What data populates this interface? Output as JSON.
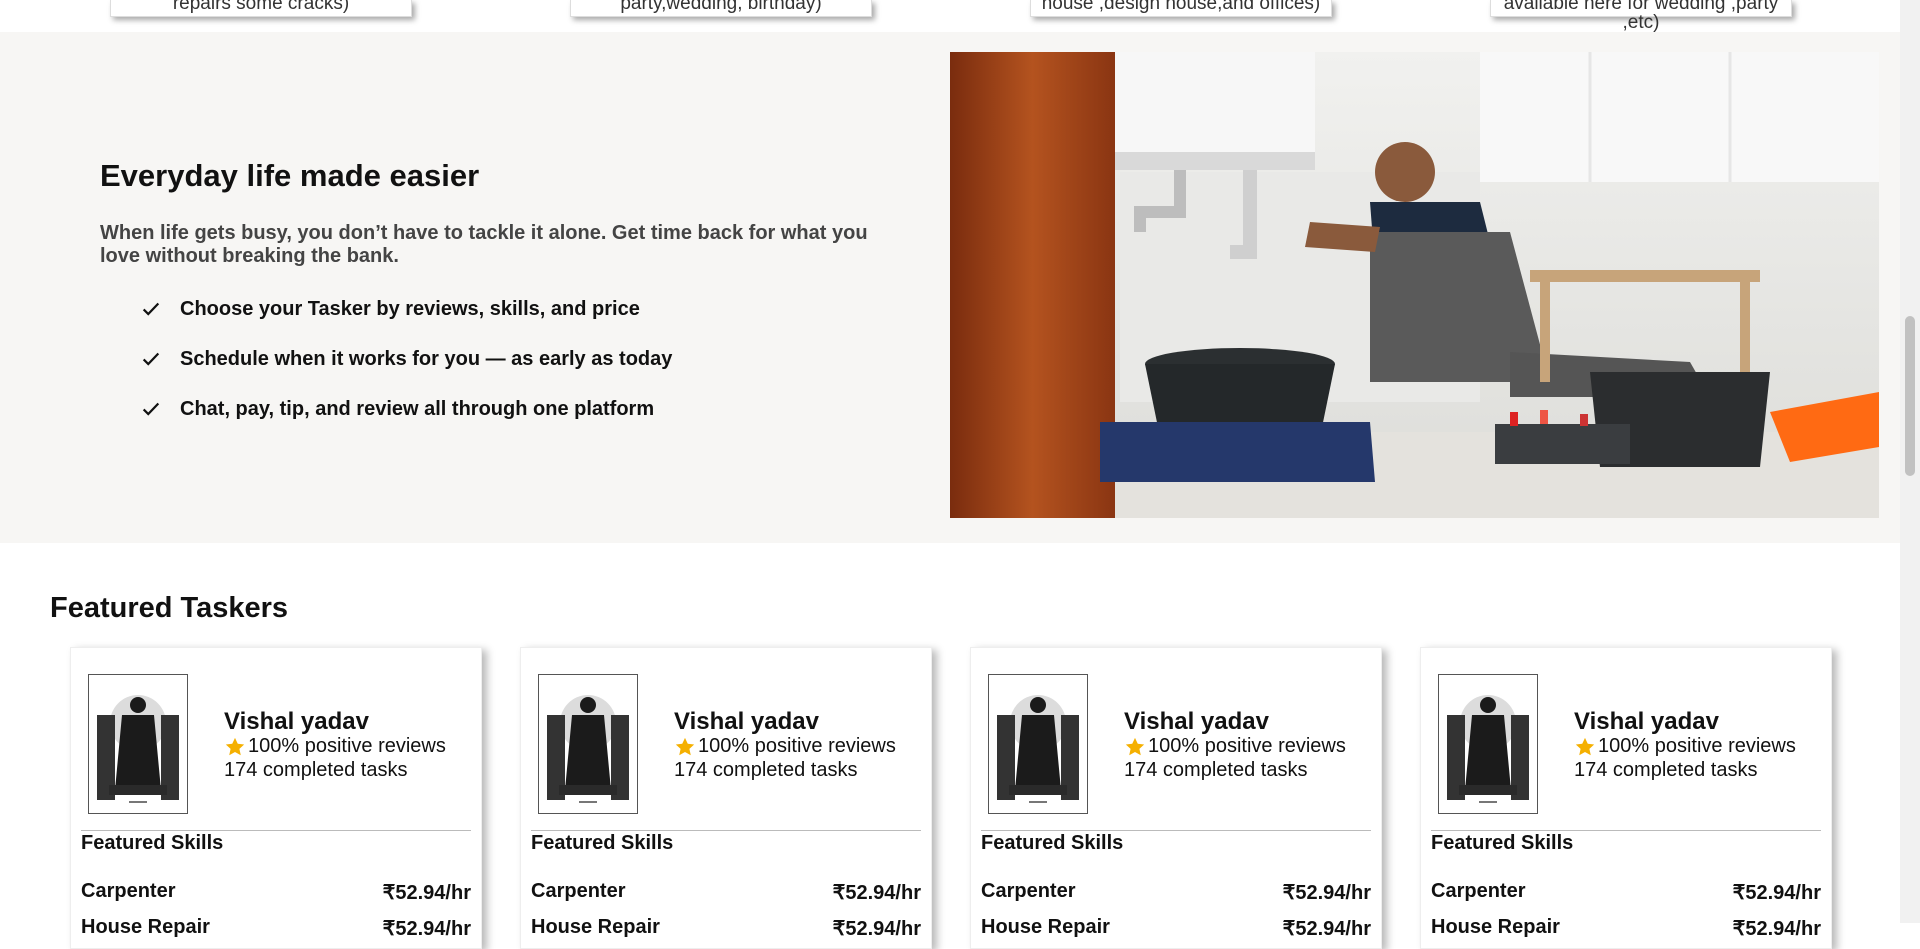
{
  "services": [
    {
      "text": "repairs some cracks)",
      "extra": ""
    },
    {
      "text": "party,wedding, birthday)",
      "extra": ""
    },
    {
      "text": "house ,design house,and offices)",
      "extra": ""
    },
    {
      "text": "available here for wedding ,party",
      "extra": ",etc)"
    }
  ],
  "hero": {
    "title": "Everyday life made easier",
    "description": "When life gets busy, you don’t have to tackle it alone. Get time back for what you love without breaking the bank.",
    "benefits": [
      "Choose your Tasker by reviews, skills, and price",
      "Schedule when it works for you — as early as today",
      "Chat, pay, tip, and review all through one platform"
    ],
    "image_icon": "plumber-photo"
  },
  "featured": {
    "title": "Featured Taskers",
    "taskers": [
      {
        "name": "Vishal yadav",
        "reviews": "100% positive reviews",
        "tasks": "174 completed tasks",
        "skills_head": "Featured Skills",
        "skills": [
          {
            "name": "Carpenter",
            "price": "₹52.94/hr"
          },
          {
            "name": "House Repair",
            "price": "₹52.94/hr"
          }
        ]
      },
      {
        "name": "Vishal yadav",
        "reviews": "100% positive reviews",
        "tasks": "174 completed tasks",
        "skills_head": "Featured Skills",
        "skills": [
          {
            "name": "Carpenter",
            "price": "₹52.94/hr"
          },
          {
            "name": "House Repair",
            "price": "₹52.94/hr"
          }
        ]
      },
      {
        "name": "Vishal yadav",
        "reviews": "100% positive reviews",
        "tasks": "174 completed tasks",
        "skills_head": "Featured Skills",
        "skills": [
          {
            "name": "Carpenter",
            "price": "₹52.94/hr"
          },
          {
            "name": "House Repair",
            "price": "₹52.94/hr"
          }
        ]
      },
      {
        "name": "Vishal yadav",
        "reviews": "100% positive reviews",
        "tasks": "174 completed tasks",
        "skills_head": "Featured Skills",
        "skills": [
          {
            "name": "Carpenter",
            "price": "₹52.94/hr"
          },
          {
            "name": "House Repair",
            "price": "₹52.94/hr"
          }
        ]
      }
    ]
  },
  "colors": {
    "hero_bg": "#f7f6f4",
    "star": "#f5b000",
    "text": "#111111"
  }
}
